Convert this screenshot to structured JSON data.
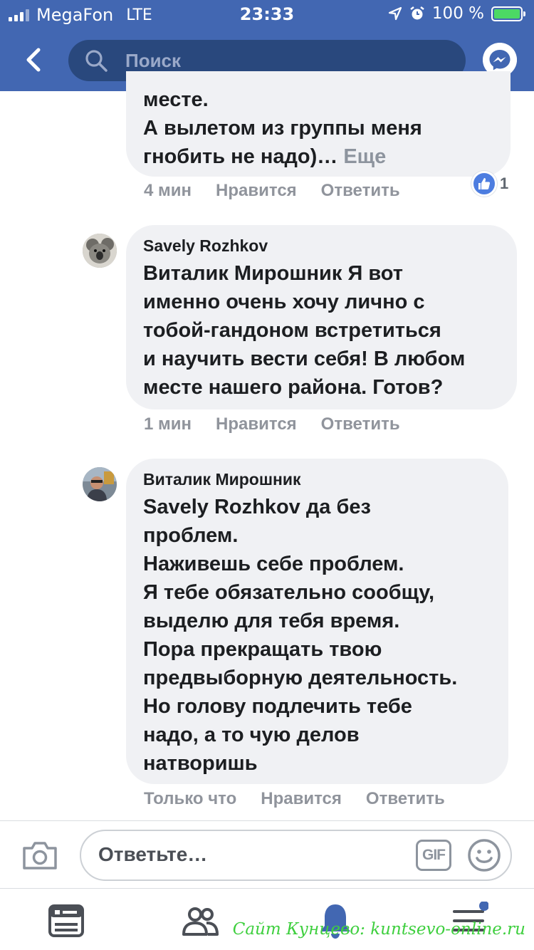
{
  "status_bar": {
    "carrier": "MegaFon",
    "network": "LTE",
    "time": "23:33",
    "battery_percent": "100 %",
    "battery_level": 1.0
  },
  "header": {
    "search_placeholder": "Поиск",
    "icons": [
      "back-chevron-icon",
      "search-icon",
      "messenger-icon"
    ]
  },
  "comments": [
    {
      "author": "",
      "text": "месте.\nА вылетом из группы меня\nгнобить не надо)…",
      "more_label": "Еще",
      "time": "4 мин",
      "like_label": "Нравится",
      "reply_label": "Ответить",
      "reactions_count": "1"
    },
    {
      "author": "Savely Rozhkov",
      "mention": "Виталик Мирошник",
      "text": "Я вот\nименно очень хочу лично с\nтобой-гандоном встретиться\nи научить вести себя! В любом\nместе нашего района. Готов?",
      "time": "1 мин",
      "like_label": "Нравится",
      "reply_label": "Ответить"
    },
    {
      "author": "Виталик Мирошник",
      "mention": "Savely Rozhkov",
      "text": "да без\nпроблем.\nНаживешь себе проблем.\nЯ тебе обязательно сообщу,\nвыделю для тебя время.\nПора прекращать твою\nпредвыборную деятельность.\nНо голову подлечить тебе\nнадо, а то чую делов\nнатворишь",
      "time": "Только что",
      "like_label": "Нравится",
      "reply_label": "Ответить"
    }
  ],
  "reply_bar": {
    "placeholder": "Ответьте…",
    "gif_label": "GIF"
  },
  "tab_bar": {
    "tabs": [
      "news-feed-icon",
      "friends-icon",
      "notifications-bell-icon",
      "menu-icon"
    ],
    "menu_has_badge": true
  },
  "watermark": "Сайт Кунцево:  kuntsevo-online.ru",
  "colors": {
    "brand_blue": "#4267b2",
    "search_bg": "#29487d",
    "bubble_bg": "#f0f1f4",
    "action_gray": "#90949c",
    "battery_green": "#4cd964",
    "watermark_green": "#3ecf3e"
  }
}
